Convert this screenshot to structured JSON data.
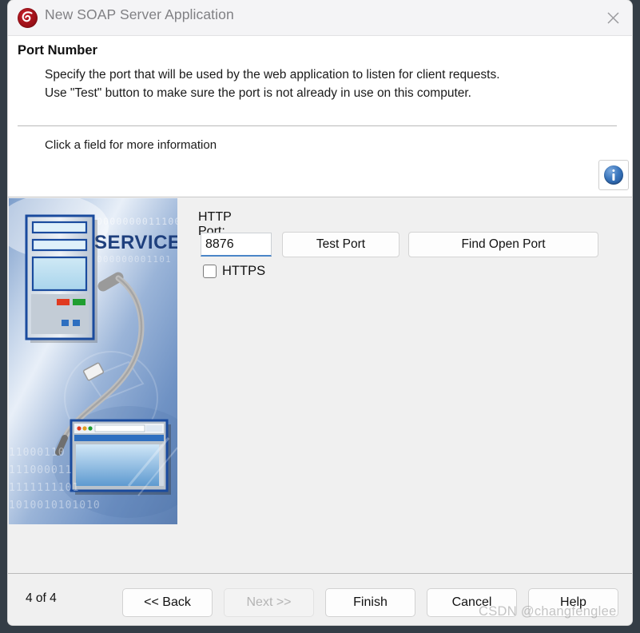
{
  "window": {
    "title": "New SOAP Server Application",
    "logo_icon": "snail-shell-logo-icon",
    "close_icon": "close-icon"
  },
  "header": {
    "page_title": "Port Number",
    "description_line1": "Specify the port that will be used by the web application to listen for client requests.",
    "description_line2": "Use \"Test\" button to make sure the port is not already in use on this computer.",
    "hint": "Click a field for more information",
    "info_icon": "info-icon"
  },
  "sidebar": {
    "art_label": "SERVICE",
    "binary_top": "0000000011100",
    "binary_rows": [
      "11000110",
      "111000011",
      "1111111101",
      "1010010101010"
    ]
  },
  "form": {
    "http_port_label": "HTTP Port:",
    "http_port_value": "8876",
    "http_port_placeholder": "",
    "test_port_label": "Test Port",
    "find_open_port_label": "Find Open Port",
    "https_label": "HTTPS",
    "https_checked": false
  },
  "footer": {
    "page_count": "4 of 4",
    "back_label": "<< Back",
    "next_label": "Next >>",
    "next_disabled": true,
    "finish_label": "Finish",
    "cancel_label": "Cancel",
    "help_label": "Help"
  },
  "watermark": {
    "text": "CSDN @changfenglee"
  },
  "colors": {
    "window_border": "#343d46",
    "accent_blue": "#4a86c8",
    "logo_red": "#9e1018",
    "panel_bg": "#f0f0f0"
  }
}
